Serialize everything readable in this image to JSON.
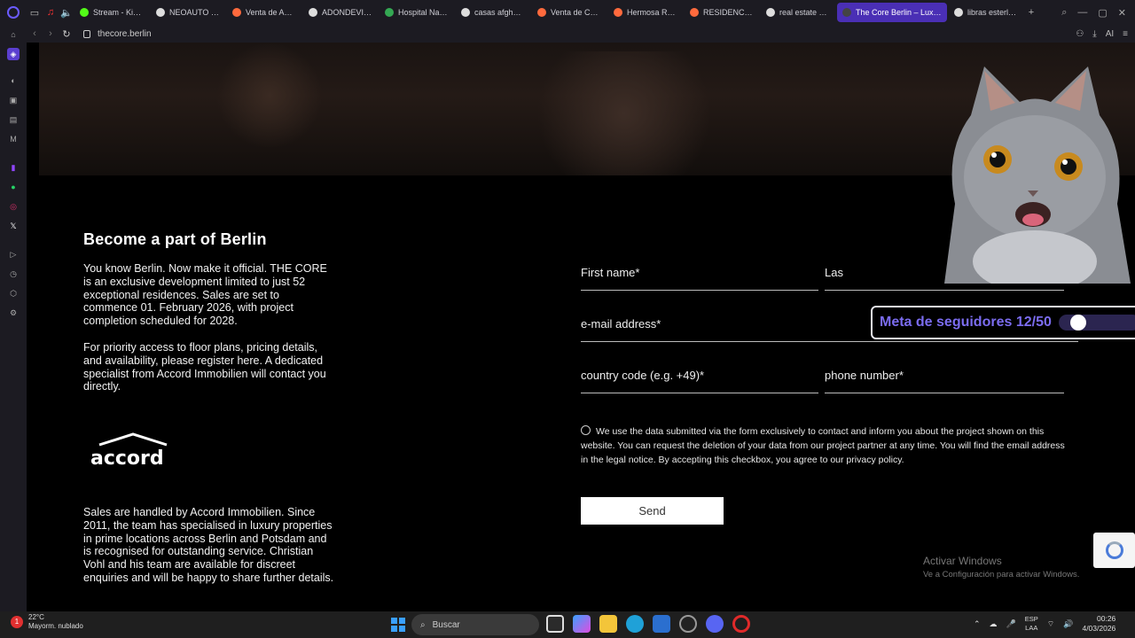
{
  "browser": {
    "tabs": [
      {
        "label": "Stream - Kick D",
        "color": "#53fc18"
      },
      {
        "label": "NEOAUTO - Bu",
        "color": "#dddddd"
      },
      {
        "label": "Venta de Autos",
        "color": "#ff6a3d"
      },
      {
        "label": "ADONDEVIVIR",
        "color": "#dddddd"
      },
      {
        "label": "Hospital Nacio",
        "color": "#34a853"
      },
      {
        "label": "casas afghanis",
        "color": "#dddddd"
      },
      {
        "label": "Venta de Casa",
        "color": "#ff6a3d"
      },
      {
        "label": "Hermosa Resid",
        "color": "#ff6a3d"
      },
      {
        "label": "RESIDENCIA E",
        "color": "#ff6a3d"
      },
      {
        "label": "real estate ber",
        "color": "#dddddd"
      },
      {
        "label": "The Core Berlin – Luxury",
        "color": "#444444"
      },
      {
        "label": "libras esterlinas",
        "color": "#dddddd"
      }
    ],
    "url": "thecore.berlin",
    "ai_label": "AI"
  },
  "page": {
    "title": "Become a part of Berlin",
    "intro": "You know Berlin. Now make it official. THE CORE is an exclusive development limited to just 52 exceptional residences. Sales are set to commence 01. February 2026, with project completion scheduled for 2028.",
    "priority": "For priority access to floor plans, pricing details, and availability, please register here. A dedicated specialist from Accord Immobilien will contact you directly.",
    "logo_text": "accord",
    "sales": "Sales are handled by Accord Immobilien. Since 2011, the team has specialised in luxury properties in prime locations across Berlin and Potsdam and is recognised for outstanding service. Christian Vohl and his team are available for discreet enquiries and will be happy to share further details."
  },
  "form": {
    "first_name": "First name*",
    "last_name": "Las",
    "email": "e-mail address*",
    "country_code": "country code (e.g. +49)*",
    "phone": "phone number*",
    "consent": "We use the data submitted via the form exclusively to contact and inform you about the project shown on this website. You can request the deletion of your data from our project partner at any time. You will find the email address in the legal notice. By accepting this checkbox, you agree to our privacy policy.",
    "send": "Send"
  },
  "overlay": {
    "meta_label": "Meta de seguidores 12/50",
    "progress_fraction": 0.24
  },
  "windows": {
    "activate_title": "Activar Windows",
    "activate_sub": "Ve a Configuración para activar Windows."
  },
  "taskbar": {
    "temp": "22°C",
    "weather": "Mayorm. nublado",
    "search": "Buscar",
    "lang1": "ESP",
    "lang2": "LAA",
    "time": "00:26",
    "date": "4/03/2026"
  }
}
